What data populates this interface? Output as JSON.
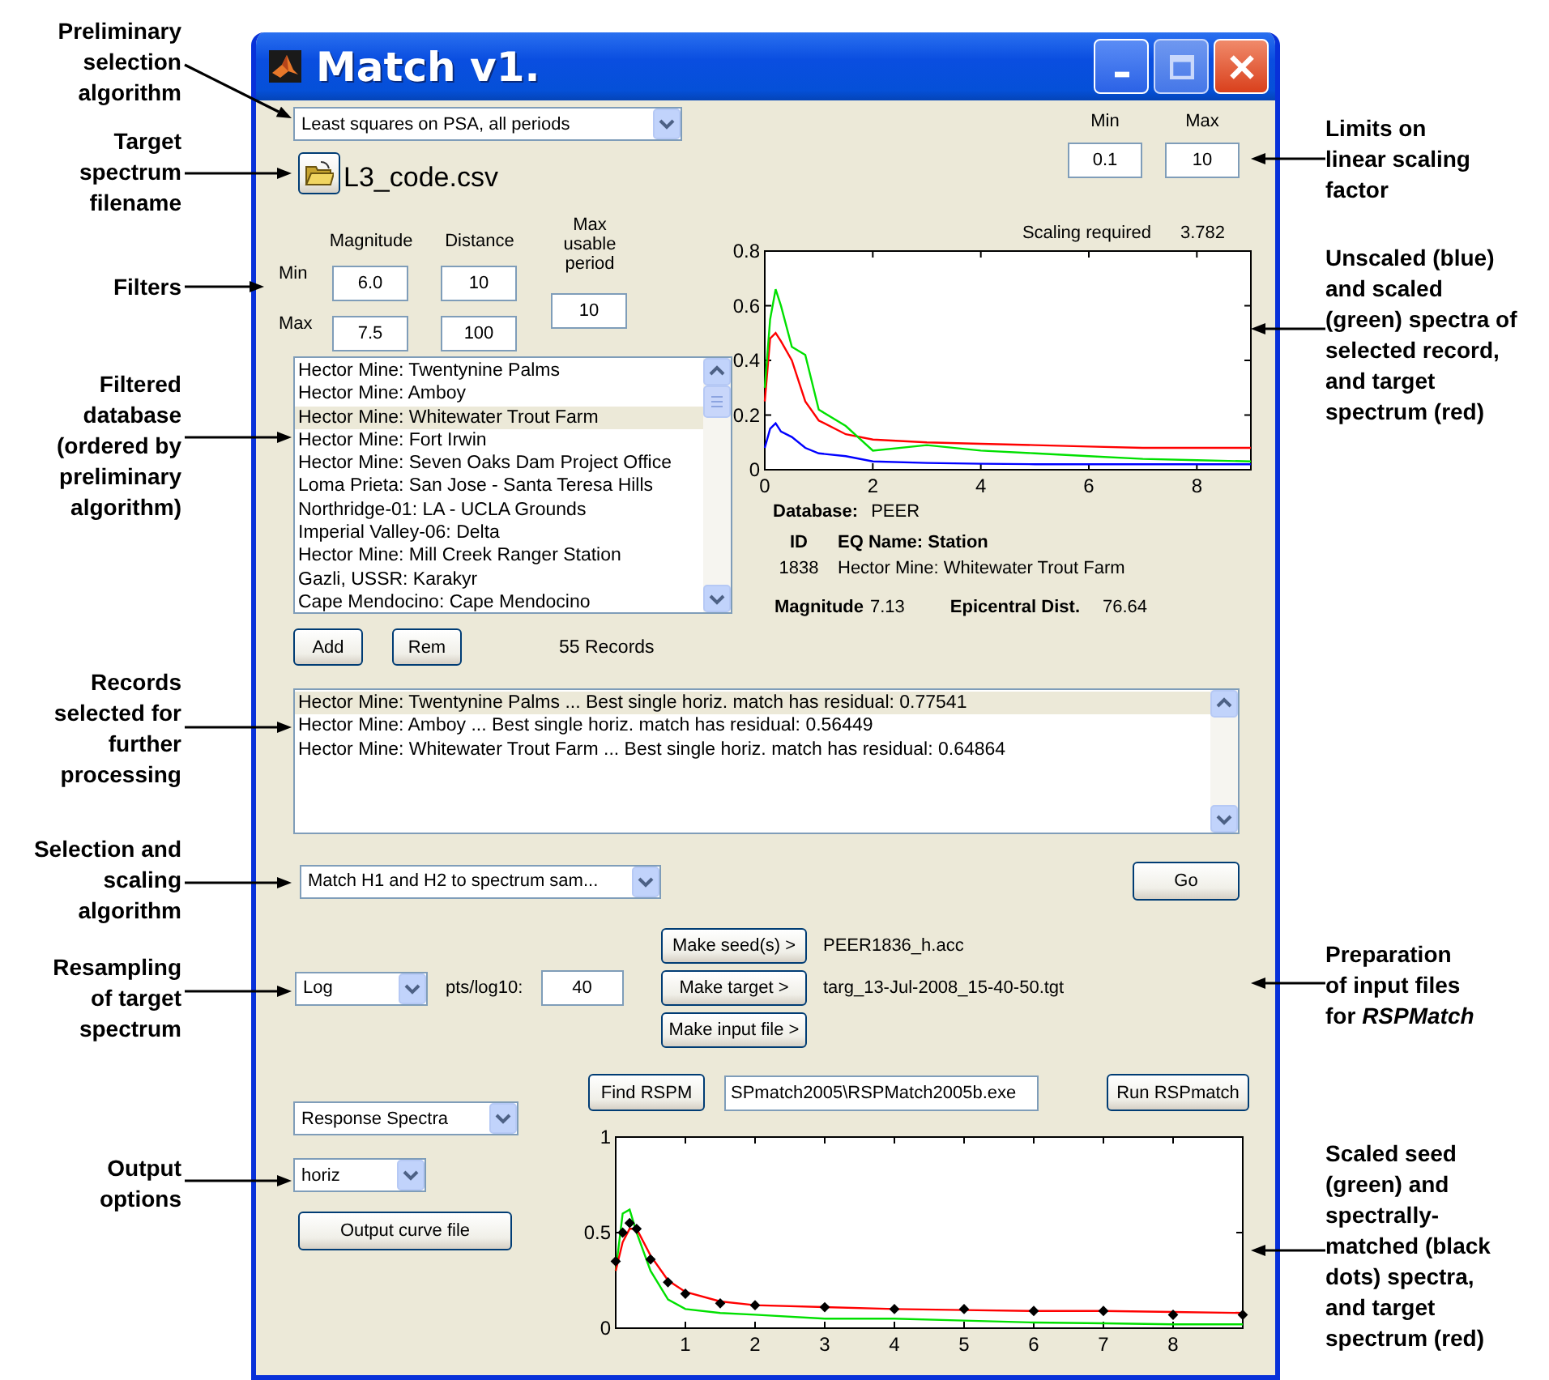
{
  "left_annotations": [
    "Preliminary\nselection\nalgorithm",
    "Target\nspectrum\nfilename",
    "Filters",
    "Filtered\ndatabase\n(ordered by\npreliminary\nalgorithm)",
    "Records\nselected for\nfurther\nprocessing",
    "Selection and\nscaling\nalgorithm",
    "Resampling\nof target\nspectrum",
    "Output\noptions"
  ],
  "right_annotations": [
    "Limits on\nlinear scaling\nfactor",
    "Unscaled (blue)\nand scaled\n(green) spectra of\nselected record,\nand target\nspectrum (red)",
    "Preparation\nof input files\nfor *RSPMatch*",
    "Scaled seed\n(green) and\nspectrally-\nmatched (black\ndots) spectra,\nand target\nspectrum (red)"
  ],
  "window": {
    "title": "Match v1."
  },
  "preliminary_algorithm": {
    "value": "Least squares on PSA, all periods"
  },
  "target_file": {
    "filename": "L3_code.csv"
  },
  "scaling_limits": {
    "min_label": "Min",
    "max_label": "Max",
    "min": "0.1",
    "max": "10"
  },
  "filters": {
    "magnitude_label": "Magnitude",
    "distance_label": "Distance",
    "period_label": "Max usable\nperiod",
    "min_label": "Min",
    "max_label": "Max",
    "magnitude_min": "6.0",
    "magnitude_max": "7.5",
    "distance_min": "10",
    "distance_max": "100",
    "max_period": "10"
  },
  "database_list": {
    "items": [
      {
        "text": "Hector Mine: Twentynine Palms",
        "selected": false
      },
      {
        "text": "Hector Mine: Amboy",
        "selected": false
      },
      {
        "text": "Hector Mine: Whitewater Trout Farm",
        "selected": true
      },
      {
        "text": "Hector Mine: Fort Irwin",
        "selected": false
      },
      {
        "text": "Hector Mine: Seven Oaks Dam Project Office",
        "selected": false
      },
      {
        "text": "Loma Prieta: San Jose - Santa Teresa Hills",
        "selected": false
      },
      {
        "text": "Northridge-01: LA - UCLA Grounds",
        "selected": false
      },
      {
        "text": "Imperial Valley-06: Delta",
        "selected": false
      },
      {
        "text": "Hector Mine: Mill Creek Ranger Station",
        "selected": false
      },
      {
        "text": "Gazli, USSR: Karakyr",
        "selected": false
      },
      {
        "text": "Cape Mendocino: Cape Mendocino",
        "selected": false
      }
    ],
    "add": "Add",
    "remove": "Rem",
    "count": "55 Records"
  },
  "scaling": {
    "label": "Scaling required",
    "value": "3.782"
  },
  "spectrum_chart": {
    "chart_data": {
      "type": "line",
      "x": [
        0,
        0.1,
        0.2,
        0.3,
        0.5,
        0.75,
        1,
        1.5,
        2,
        3,
        4,
        5,
        6,
        7,
        8,
        9
      ],
      "xlim": [
        0,
        9
      ],
      "ylim": [
        0,
        0.8
      ],
      "xticks": [
        0,
        2,
        4,
        6,
        8
      ],
      "yticks": [
        0,
        0.2,
        0.4,
        0.6,
        0.8
      ],
      "series": [
        {
          "color": "#ff0000",
          "values": [
            0.25,
            0.48,
            0.5,
            0.47,
            0.4,
            0.25,
            0.18,
            0.13,
            0.11,
            0.1,
            0.095,
            0.09,
            0.085,
            0.08,
            0.08,
            0.08
          ]
        },
        {
          "color": "#00e000",
          "values": [
            0.3,
            0.55,
            0.66,
            0.6,
            0.45,
            0.42,
            0.22,
            0.16,
            0.07,
            0.09,
            0.07,
            0.06,
            0.05,
            0.04,
            0.035,
            0.03
          ]
        },
        {
          "color": "#0000ff",
          "values": [
            0.08,
            0.15,
            0.17,
            0.14,
            0.12,
            0.08,
            0.06,
            0.05,
            0.03,
            0.025,
            0.022,
            0.02,
            0.02,
            0.02,
            0.02,
            0.02
          ]
        }
      ]
    }
  },
  "record_info": {
    "database_label": "Database:",
    "database": "PEER",
    "id_header": "ID",
    "name_header": "EQ Name: Station",
    "id": "1838",
    "name": "Hector Mine: Whitewater Trout Farm",
    "magnitude_label": "Magnitude",
    "magnitude": "7.13",
    "distance_label": "Epicentral Dist.",
    "distance": "76.64"
  },
  "selected_records": {
    "items": [
      {
        "text": "Hector Mine: Twentynine Palms  ...  Best single horiz. match has residual: 0.77541",
        "selected": true
      },
      {
        "text": "Hector Mine: Amboy  ...  Best single horiz. match has residual: 0.56449",
        "selected": false
      },
      {
        "text": "Hector Mine: Whitewater Trout Farm  ...  Best single horiz. match has residual: 0.64864",
        "selected": false
      }
    ]
  },
  "matching_algorithm": {
    "value": "Match H1 and H2 to spectrum sam...",
    "go": "Go"
  },
  "resampling": {
    "mode": "Log",
    "pts_label": "pts/log10:",
    "pts": "40"
  },
  "input_files": [
    {
      "button": "Make seed(s) >",
      "file": "PEER1836_h.acc"
    },
    {
      "button": "Make target >",
      "file": "targ_13-Jul-2008_15-40-50.tgt"
    },
    {
      "button": "Make input file >"
    }
  ],
  "output": {
    "type": "Response Spectra",
    "component": "horiz",
    "button": "Output curve file"
  },
  "rspmatch": {
    "find": "Find RSPM",
    "path": "SPmatch2005\\RSPMatch2005b.exe",
    "run": "Run RSPmatch"
  },
  "matched_chart": {
    "chart_data": {
      "type": "line",
      "x": [
        0,
        0.1,
        0.2,
        0.3,
        0.5,
        0.75,
        1,
        1.5,
        2,
        3,
        4,
        5,
        6,
        7,
        8,
        9
      ],
      "xlim": [
        0,
        9
      ],
      "ylim": [
        0,
        1
      ],
      "xticks": [
        1,
        2,
        3,
        4,
        5,
        6,
        7,
        8
      ],
      "yticks": [
        0,
        0.5,
        1
      ],
      "series": [
        {
          "color": "#00e000",
          "values": [
            0.3,
            0.6,
            0.62,
            0.5,
            0.3,
            0.15,
            0.1,
            0.08,
            0.07,
            0.05,
            0.05,
            0.04,
            0.03,
            0.025,
            0.02,
            0.02
          ]
        },
        {
          "color": "#ff0000",
          "values": [
            0.3,
            0.45,
            0.52,
            0.52,
            0.38,
            0.25,
            0.19,
            0.14,
            0.12,
            0.11,
            0.1,
            0.095,
            0.09,
            0.09,
            0.085,
            0.08
          ]
        },
        {
          "color": "#000000",
          "type": "scatter",
          "values": [
            0.35,
            0.5,
            0.55,
            0.52,
            0.36,
            0.24,
            0.18,
            0.13,
            0.12,
            0.11,
            0.1,
            0.1,
            0.09,
            0.09,
            0.07,
            0.07
          ]
        }
      ]
    }
  }
}
